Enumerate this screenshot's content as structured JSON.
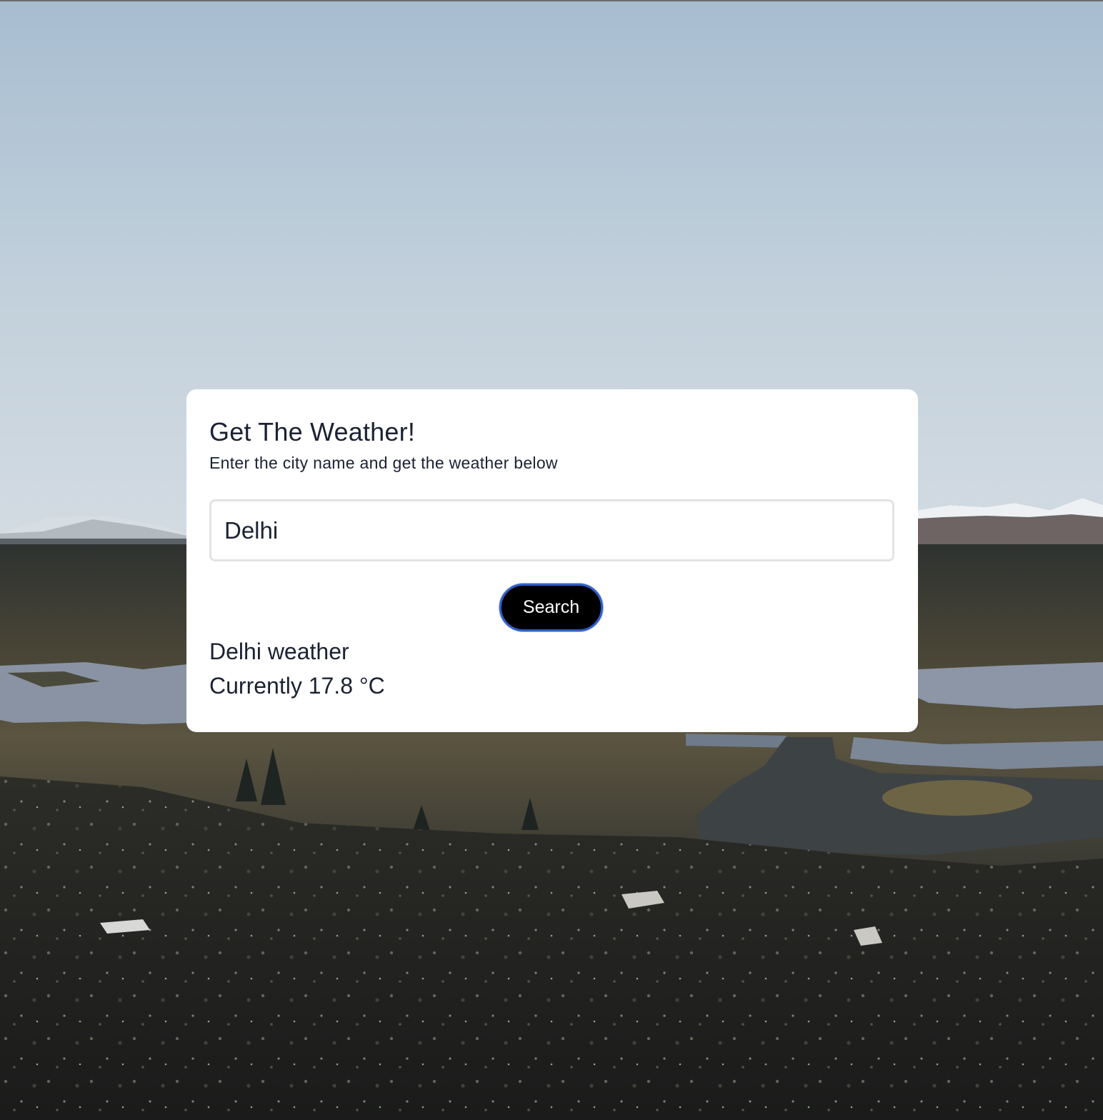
{
  "card": {
    "title": "Get The Weather!",
    "subtitle": "Enter the city name and get the weather below"
  },
  "search": {
    "value": "Delhi",
    "button_label": "Search"
  },
  "result": {
    "city_line": "Delhi weather",
    "temp_line": "Currently 17.8 °C"
  },
  "colors": {
    "button_bg": "#000000",
    "button_border": "#2f5fc2",
    "text": "#1b2233",
    "card_bg": "#ffffff"
  }
}
